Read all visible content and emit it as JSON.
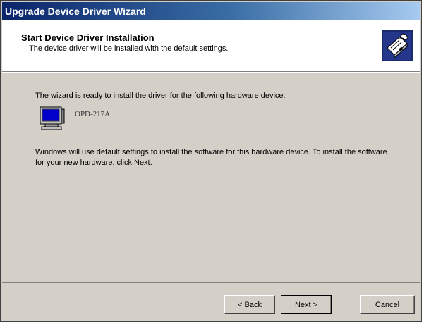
{
  "window": {
    "title": "Upgrade Device Driver Wizard"
  },
  "header": {
    "title": "Start Device Driver Installation",
    "subtitle": "The device driver will be installed with the default settings.",
    "icon": "hardware-wizard-icon"
  },
  "content": {
    "intro": "The wizard is ready to install the driver for the following hardware device:",
    "device": {
      "name": "OPD-217A",
      "icon": "monitor-icon"
    },
    "instructions": "Windows will use default settings to install the software for this hardware device. To install the software for your new hardware, click Next."
  },
  "buttons": {
    "back": "< Back",
    "next": "Next >",
    "cancel": "Cancel"
  },
  "colors": {
    "titlebar_start": "#0a246a",
    "titlebar_end": "#a6caf0",
    "face": "#d4d0c8"
  }
}
